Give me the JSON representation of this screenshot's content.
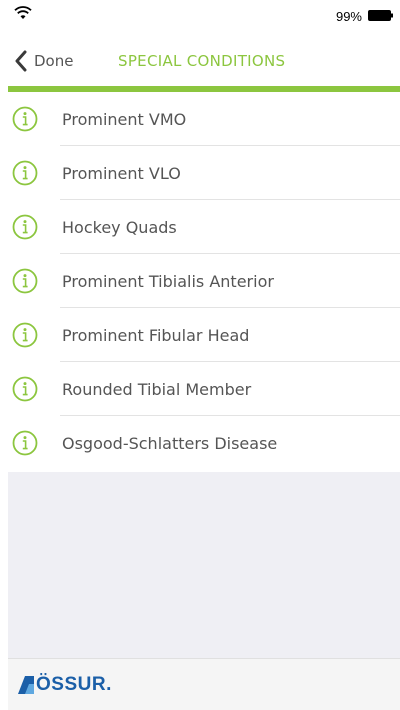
{
  "status_bar": {
    "battery_percent": "99%",
    "wifi_icon": "wifi-icon",
    "battery_icon": "battery-icon"
  },
  "nav": {
    "back_label": "Done",
    "title": "SPECIAL CONDITIONS",
    "back_icon": "chevron-left-icon"
  },
  "conditions": {
    "items": [
      {
        "label": "Prominent VMO"
      },
      {
        "label": "Prominent VLO"
      },
      {
        "label": "Hockey Quads"
      },
      {
        "label": "Prominent Tibialis Anterior"
      },
      {
        "label": "Prominent Fibular Head"
      },
      {
        "label": "Rounded Tibial Member"
      },
      {
        "label": "Osgood-Schlatters Disease"
      }
    ],
    "item_icon": "info-icon"
  },
  "footer": {
    "logo_text": "ÖSSUR."
  },
  "colors": {
    "accent_green": "#8cc63f",
    "brand_blue": "#1b5fa8",
    "text_gray": "#555555",
    "empty_bg": "#efeff4"
  }
}
